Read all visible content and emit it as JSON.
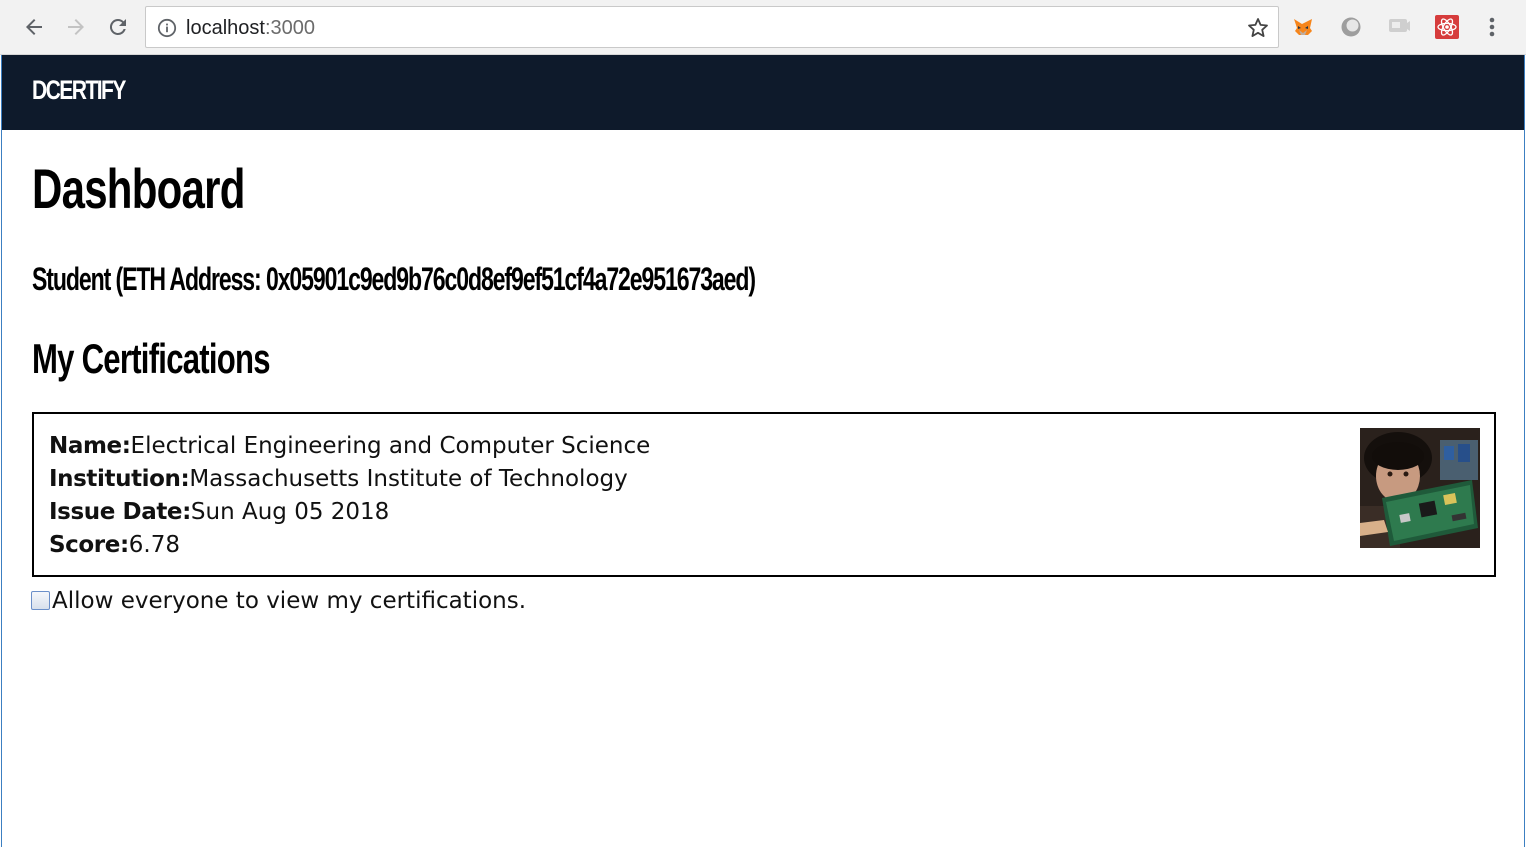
{
  "browser": {
    "url_host": "localhost",
    "url_port": ":3000"
  },
  "navbar": {
    "brand": "DCERTIFY"
  },
  "main": {
    "title": "Dashboard",
    "student_line": "Student (ETH Address: 0x05901c9ed9b76c0d8ef9ef51cf4a72e951673aed)",
    "certifications_heading": "My Certifications"
  },
  "certifications": [
    {
      "name_label": "Name:",
      "name": "Electrical Engineering and Computer Science",
      "institution_label": "Institution:",
      "institution": "Massachusetts Institute of Technology",
      "issue_date_label": "Issue Date:",
      "issue_date": "Sun Aug 05 2018",
      "score_label": "Score:",
      "score": "6.78"
    }
  ],
  "sharing": {
    "label": "Allow everyone to view my certifications.",
    "checked": false
  },
  "colors": {
    "navbar_bg": "#0e1a2b",
    "text": "#000000"
  }
}
